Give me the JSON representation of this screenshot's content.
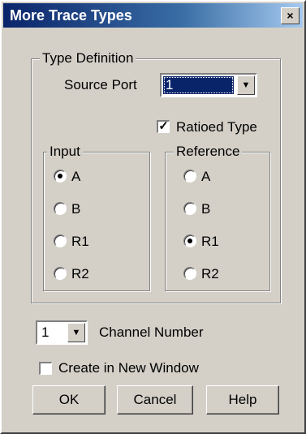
{
  "dialog": {
    "title": "More Trace Types",
    "close_glyph": "×"
  },
  "type_definition": {
    "legend": "Type Definition",
    "source_port_label": "Source Port",
    "source_port_value": "1",
    "ratioed_type_label": "Ratioed Type",
    "ratioed_type_checked": true
  },
  "input_group": {
    "legend": "Input",
    "options": [
      "A",
      "B",
      "R1",
      "R2"
    ],
    "selected": "A"
  },
  "reference_group": {
    "legend": "Reference",
    "options": [
      "A",
      "B",
      "R1",
      "R2"
    ],
    "selected": "R1"
  },
  "channel": {
    "value": "1",
    "label": "Channel Number"
  },
  "new_window": {
    "label": "Create in New Window",
    "checked": false
  },
  "buttons": {
    "ok": "OK",
    "cancel": "Cancel",
    "help": "Help"
  },
  "glyphs": {
    "dropdown": "▼",
    "check": "✓"
  }
}
